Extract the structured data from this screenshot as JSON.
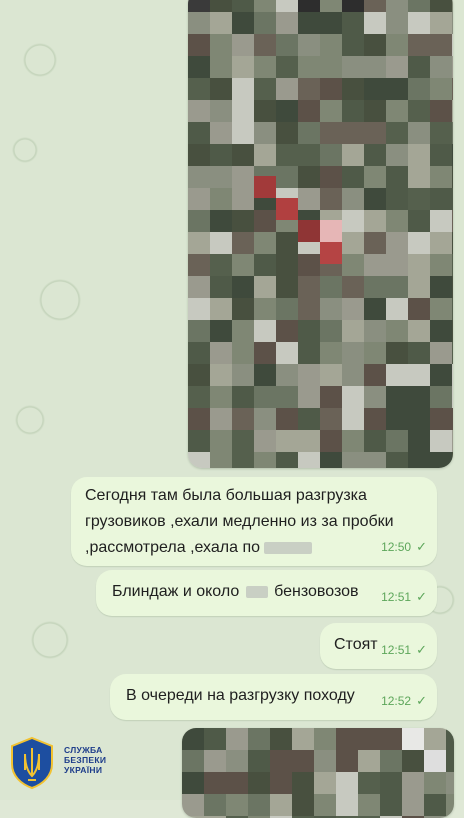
{
  "messages": [
    {
      "text_lines": [
        "Сегодня там была большая разгрузка",
        "грузовиков ,ехали медленно из за пробки",
        ",рассмотрела ,ехала по"
      ],
      "time": "12:50",
      "status": "✓"
    },
    {
      "text_before": "Блиндаж и около",
      "text_after": "бензовозов",
      "time": "12:51",
      "status": "✓"
    },
    {
      "text": "Стоят",
      "time": "12:51",
      "status": "✓"
    },
    {
      "text": "В очереди на разгрузку походу",
      "time": "12:52",
      "status": "✓"
    }
  ],
  "logo": {
    "lines": [
      "СЛУЖБА",
      "БЕЗПЕКИ",
      "УКРАЇНИ"
    ]
  },
  "colors": {
    "bubble": "#eaf7dc",
    "time": "#5da65a",
    "wallpaper": "#dbe6d2",
    "logo": "#1d3c8a"
  }
}
